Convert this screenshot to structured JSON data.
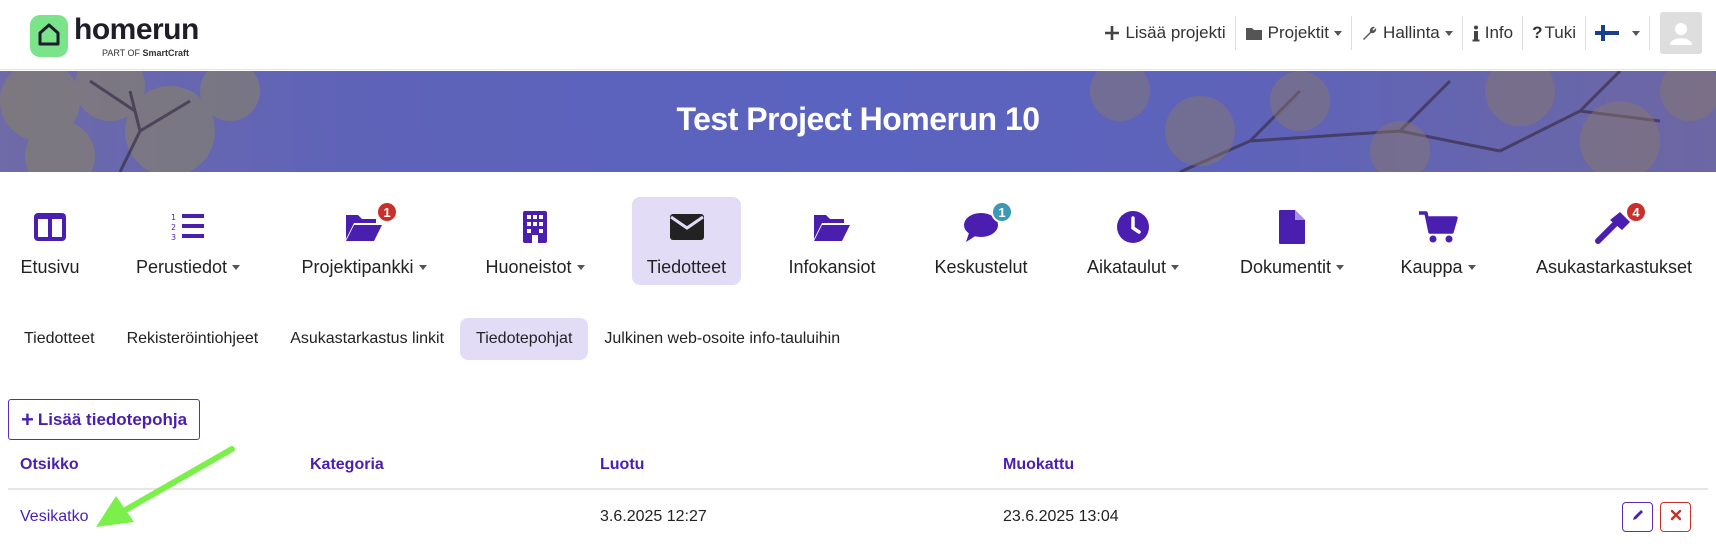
{
  "app": {
    "logo_word": "homerun",
    "logo_sub_prefix": "PART OF",
    "logo_sub_brand": "SmartCraft"
  },
  "topnav": {
    "add_project": "Lisää projekti",
    "projects": "Projektit",
    "admin": "Hallinta",
    "info": "Info",
    "support": "Tuki",
    "language_icon": "finland-flag-icon",
    "avatar_icon": "user-avatar-icon"
  },
  "banner": {
    "title": "Test Project Homerun 10"
  },
  "modules": [
    {
      "label": "Etusivu",
      "icon": "columns-icon"
    },
    {
      "label": "Perustiedot",
      "icon": "numbered-list-icon"
    },
    {
      "label": "Projektipankki",
      "icon": "folder-open-icon",
      "badge": "1"
    },
    {
      "label": "Huoneistot",
      "icon": "building-icon"
    },
    {
      "label": "Tiedotteet",
      "icon": "envelope-icon"
    },
    {
      "label": "Infokansiot",
      "icon": "folder-open-icon"
    },
    {
      "label": "Keskustelut",
      "icon": "comment-icon",
      "badge": "1"
    },
    {
      "label": "Aikataulut",
      "icon": "clock-icon"
    },
    {
      "label": "Dokumentit",
      "icon": "file-icon"
    },
    {
      "label": "Kauppa",
      "icon": "cart-icon"
    },
    {
      "label": "Asukastarkastukset",
      "icon": "hammer-icon",
      "badge": "4"
    }
  ],
  "subtabs": [
    {
      "label": "Tiedotteet"
    },
    {
      "label": "Rekisteröintiohjeet"
    },
    {
      "label": "Asukastarkastus linkit"
    },
    {
      "label": "Tiedotepohjat"
    },
    {
      "label": "Julkinen web-osoite info-tauluihin"
    }
  ],
  "add_button": {
    "label": "Lisää tiedotepohja"
  },
  "table": {
    "headers": [
      "Otsikko",
      "Kategoria",
      "Luotu",
      "Muokattu"
    ],
    "rows": [
      {
        "title": "Vesikatko",
        "category": "",
        "created": "3.6.2025 12:27",
        "modified": "23.6.2025 13:04"
      }
    ]
  },
  "colors": {
    "accent": "#4a1fb0",
    "active_bg": "#e2dcf7",
    "badge_red": "#c9302c",
    "badge_teal": "#3c98b4",
    "annotation_arrow": "#7cf04a"
  }
}
